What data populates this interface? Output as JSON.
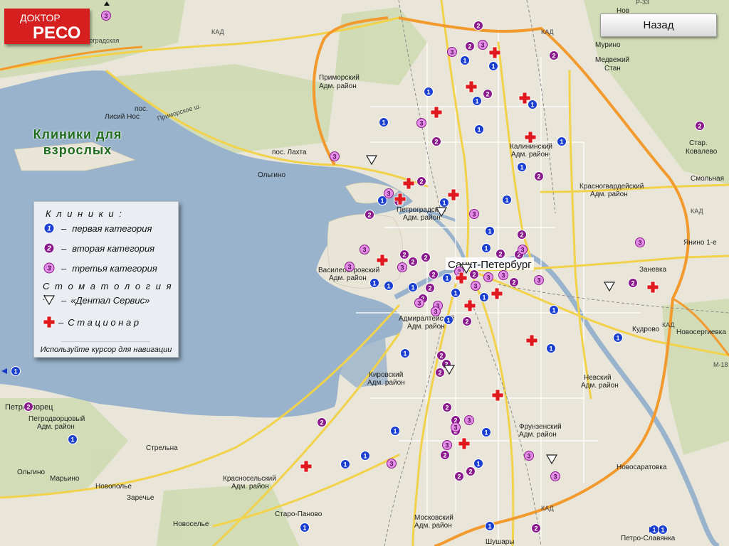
{
  "header": {
    "logo_line1": "ДОКТОР",
    "logo_line2": "РЕСО",
    "back_label": "Назад"
  },
  "map_title_line1": "Клиники для",
  "map_title_line2": "взрослых",
  "legend": {
    "clinics_header": "К л и н и к и :",
    "cat1_label": "первая категория",
    "cat2_label": "вторая категория",
    "cat3_label": "третья категория",
    "dash": "–",
    "stomatology_header": "С т о м а т о л о г и я :",
    "dental_label": "«Дентал Сервис»",
    "hospital_label": "С т а ц и о н а р",
    "hint": "Используйте курсор для навигации"
  },
  "places": {
    "spb": "Санкт-Петербург",
    "murino": "Мурино",
    "medvezhiy": "Медвежий",
    "stan": "Стан",
    "staroe_kovalevo_1": "Стар.",
    "staroe_kovalevo_2": "Ковалево",
    "smolnaya": "Смольная",
    "yanino": "Янино 1-е",
    "zanevka": "Заневка",
    "kudrovo": "Кудрово",
    "novosergievka": "Новосергиевка",
    "novosaratovka": "Новосаратовка",
    "petro_slavyanka": "Петро-Славянка",
    "shushary": "Шушары",
    "staro_panovo": "Старо-Паново",
    "novoselye": "Новоселье",
    "marino": "Марьино",
    "novopolye": "Новополье",
    "zarechye": "Заречье",
    "strelna": "Стрельна",
    "olgino_village": "Ольгино",
    "petrodvorets": "Петродворец",
    "lisiy_nos": "Лисий Нос",
    "pos": "пос.",
    "lakhta": "пос. Лахта",
    "olgino": "Ольгино",
    "primorsky_1": "Приморский",
    "primorsky_2": "Адм. район",
    "kalininsky_1": "Калининский",
    "kalininsky_2": "Адм. район",
    "krasnogvard_1": "Красногвардейский",
    "krasnogvard_2": "Адм. район",
    "petrogradsky_1": "Петроградский",
    "petrogradsky_2": "Адм. район",
    "vasileostr_1": "Василеостровский",
    "vasileostr_2": "Адм. район",
    "admiralt_1": "Адмиралтейский",
    "admiralt_2": "Адм. район",
    "kirovsky_1": "Кировский",
    "kirovsky_2": "Адм. район",
    "frunzensky_1": "Фрунзенский",
    "frunzensky_2": "Адм. район",
    "nevsky_1": "Невский",
    "nevsky_2": "Адм. район",
    "krasnoselsky_1": "Красносельский",
    "krasnoselsky_2": "Адм. район",
    "petrodvortsovy_1": "Петродворцовый",
    "petrodvortsovy_2": "Адм. район",
    "moskovsky_1": "Московский",
    "moskovsky_2": "Адм. район",
    "primorsk_rd": "Приморское ш.",
    "zelenodorsk": "Зеленоградская",
    "kad1": "КАД",
    "kad2": "КАД",
    "kad3": "КАД",
    "kad4": "КАД",
    "kad5": "КАД",
    "p33": "Р-33",
    "m18": "М-18",
    "nov": "Нов"
  },
  "markers": {
    "cat1": [
      [
        653,
        85
      ],
      [
        693,
        93
      ],
      [
        602,
        129
      ],
      [
        670,
        142
      ],
      [
        748,
        147
      ],
      [
        673,
        182
      ],
      [
        539,
        172
      ],
      [
        789,
        199
      ],
      [
        733,
        235
      ],
      [
        537,
        282
      ],
      [
        624,
        285
      ],
      [
        712,
        281
      ],
      [
        688,
        325
      ],
      [
        683,
        349
      ],
      [
        526,
        398
      ],
      [
        546,
        402
      ],
      [
        580,
        404
      ],
      [
        628,
        391
      ],
      [
        640,
        412
      ],
      [
        680,
        418
      ],
      [
        630,
        450
      ],
      [
        778,
        436
      ],
      [
        868,
        475
      ],
      [
        569,
        497
      ],
      [
        774,
        490
      ],
      [
        555,
        606
      ],
      [
        683,
        608
      ],
      [
        513,
        641
      ],
      [
        485,
        653
      ],
      [
        672,
        652
      ],
      [
        428,
        742
      ],
      [
        688,
        740
      ],
      [
        102,
        618
      ],
      [
        919,
        745
      ],
      [
        931,
        745
      ],
      [
        22,
        522
      ]
    ],
    "cat2": [
      [
        672,
        36
      ],
      [
        660,
        65
      ],
      [
        778,
        78
      ],
      [
        685,
        132
      ],
      [
        613,
        199
      ],
      [
        757,
        248
      ],
      [
        592,
        255
      ],
      [
        519,
        302
      ],
      [
        560,
        283
      ],
      [
        733,
        330
      ],
      [
        703,
        357
      ],
      [
        729,
        358
      ],
      [
        568,
        358
      ],
      [
        598,
        362
      ],
      [
        580,
        368
      ],
      [
        609,
        386
      ],
      [
        666,
        386
      ],
      [
        604,
        405
      ],
      [
        594,
        420
      ],
      [
        722,
        397
      ],
      [
        889,
        398
      ],
      [
        656,
        452
      ],
      [
        620,
        500
      ],
      [
        627,
        512
      ],
      [
        618,
        524
      ],
      [
        628,
        573
      ],
      [
        452,
        594
      ],
      [
        640,
        591
      ],
      [
        640,
        606
      ],
      [
        625,
        640
      ],
      [
        983,
        177
      ],
      [
        40,
        572
      ],
      [
        753,
        743
      ],
      [
        645,
        670
      ],
      [
        661,
        663
      ]
    ],
    "cat3": [
      [
        149,
        22
      ],
      [
        635,
        73
      ],
      [
        678,
        63
      ],
      [
        592,
        173
      ],
      [
        470,
        220
      ],
      [
        546,
        272
      ],
      [
        666,
        301
      ],
      [
        512,
        351
      ],
      [
        734,
        351
      ],
      [
        491,
        375
      ],
      [
        565,
        376
      ],
      [
        645,
        382
      ],
      [
        686,
        390
      ],
      [
        707,
        387
      ],
      [
        757,
        394
      ],
      [
        668,
        402
      ],
      [
        589,
        426
      ],
      [
        615,
        430
      ],
      [
        612,
        438
      ],
      [
        659,
        591
      ],
      [
        640,
        601
      ],
      [
        628,
        626
      ],
      [
        743,
        641
      ],
      [
        550,
        652
      ],
      [
        780,
        670
      ],
      [
        899,
        341
      ]
    ],
    "dental": [
      [
        522,
        225
      ],
      [
        620,
        298
      ],
      [
        655,
        378
      ],
      [
        856,
        403
      ],
      [
        631,
        520
      ],
      [
        775,
        646
      ]
    ],
    "hospital": [
      [
        695,
        74
      ],
      [
        662,
        122
      ],
      [
        737,
        138
      ],
      [
        613,
        158
      ],
      [
        745,
        193
      ],
      [
        574,
        258
      ],
      [
        562,
        280
      ],
      [
        637,
        274
      ],
      [
        537,
        366
      ],
      [
        648,
        391
      ],
      [
        698,
        413
      ],
      [
        660,
        430
      ],
      [
        747,
        479
      ],
      [
        699,
        556
      ],
      [
        652,
        624
      ],
      [
        430,
        656
      ],
      [
        917,
        404
      ]
    ]
  }
}
